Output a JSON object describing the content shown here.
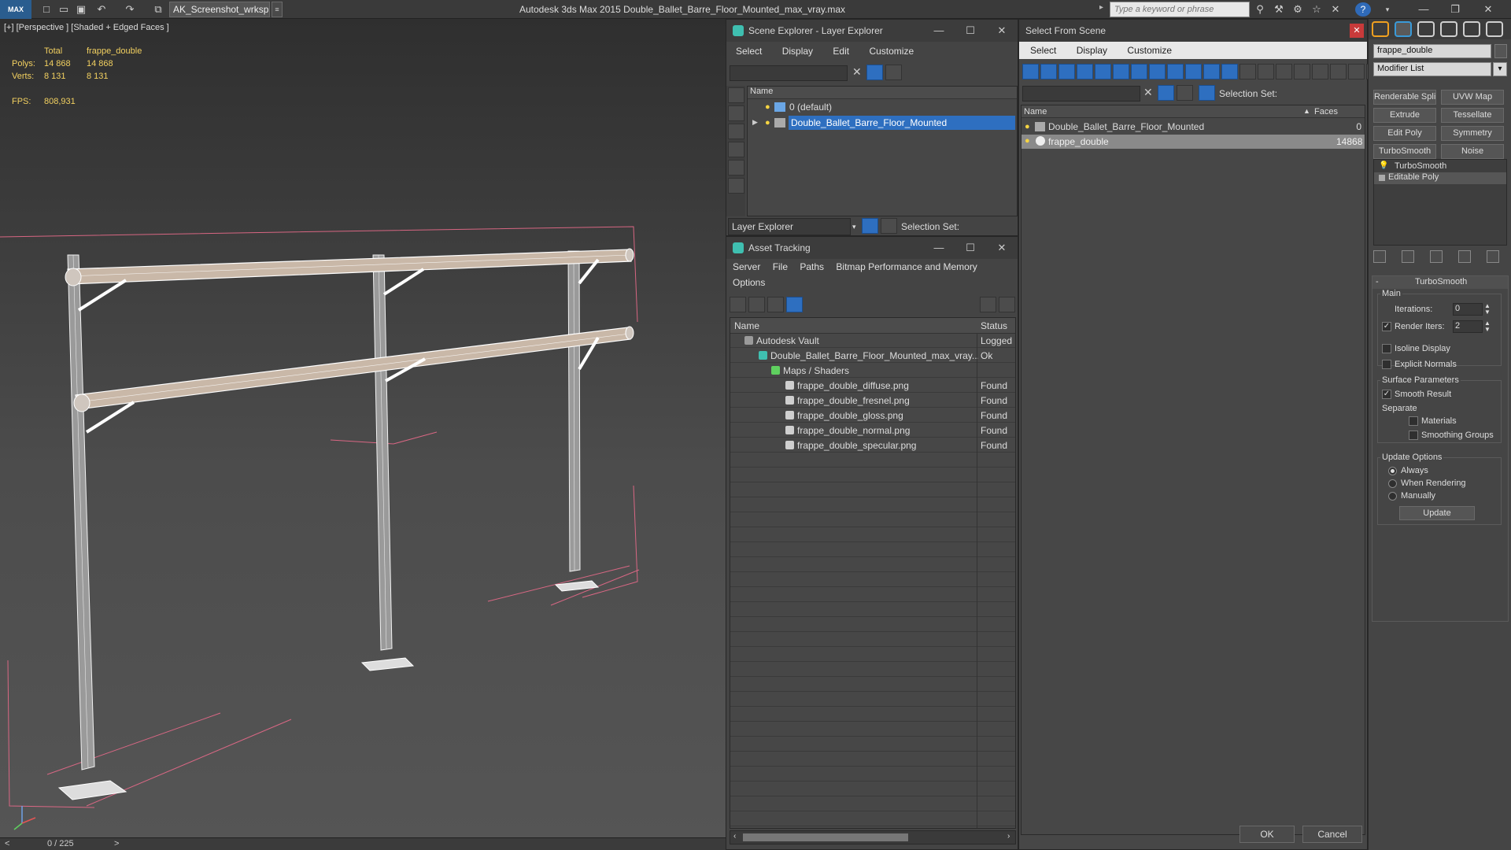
{
  "titlebar": {
    "app_logo": "MAX",
    "workspace": "AK_Screenshot_wrksp",
    "title": "Autodesk 3ds Max  2015     Double_Ballet_Barre_Floor_Mounted_max_vray.max",
    "search_placeholder": "Type a keyword or phrase"
  },
  "viewport": {
    "label": "[+] [Perspective ] [Shaded + Edged Faces ]",
    "stats_col1": "Total",
    "stats_col2": "frappe_double",
    "polys_label": "Polys:",
    "polys_total": "14 868",
    "polys_sel": "14 868",
    "verts_label": "Verts:",
    "verts_total": "8 131",
    "verts_sel": "8 131",
    "fps_label": "FPS:",
    "fps_value": "808,931",
    "time_slider": "0 / 225",
    "time_prev": "<",
    "time_next": ">"
  },
  "scene_explorer": {
    "title": "Scene Explorer - Layer Explorer",
    "menus": [
      "Select",
      "Display",
      "Edit",
      "Customize"
    ],
    "col_name": "Name",
    "layers": [
      "0 (default)",
      "Double_Ballet_Barre_Floor_Mounted"
    ],
    "footer_dropdown": "Layer Explorer",
    "selection_set": "Selection Set:"
  },
  "asset_tracking": {
    "title": "Asset Tracking",
    "menus": [
      "Server",
      "File",
      "Paths",
      "Bitmap Performance and Memory"
    ],
    "menu_options": "Options",
    "col_name": "Name",
    "col_status": "Status",
    "rows": [
      {
        "name": "Autodesk Vault",
        "status": "Logged"
      },
      {
        "name": "Double_Ballet_Barre_Floor_Mounted_max_vray....",
        "status": "Ok"
      },
      {
        "name": "Maps / Shaders",
        "status": ""
      },
      {
        "name": "frappe_double_diffuse.png",
        "status": "Found"
      },
      {
        "name": "frappe_double_fresnel.png",
        "status": "Found"
      },
      {
        "name": "frappe_double_gloss.png",
        "status": "Found"
      },
      {
        "name": "frappe_double_normal.png",
        "status": "Found"
      },
      {
        "name": "frappe_double_specular.png",
        "status": "Found"
      }
    ]
  },
  "select_from_scene": {
    "title": "Select From Scene",
    "menus": [
      "Select",
      "Display",
      "Customize"
    ],
    "selection_set": "Selection Set:",
    "col_name": "Name",
    "col_faces": "Faces",
    "rows": [
      {
        "name": "Double_Ballet_Barre_Floor_Mounted",
        "faces": "0"
      },
      {
        "name": "frappe_double",
        "faces": "14868"
      }
    ],
    "ok": "OK",
    "cancel": "Cancel"
  },
  "command_panel": {
    "object_name": "frappe_double",
    "modifier_list": "Modifier List",
    "mod_buttons": [
      "Renderable Spline",
      "UVW Map",
      "Extrude",
      "Tessellate",
      "Edit Poly",
      "Symmetry",
      "TurboSmooth",
      "Noise"
    ],
    "stack": [
      "TurboSmooth",
      "Editable Poly"
    ],
    "rollout": "TurboSmooth",
    "main": "Main",
    "iterations_label": "Iterations:",
    "iterations": "0",
    "render_iters_label": "Render Iters:",
    "render_iters": "2",
    "isoline": "Isoline Display",
    "explicit": "Explicit Normals",
    "surface": "Surface Parameters",
    "smooth_result": "Smooth Result",
    "separate": "Separate",
    "materials": "Materials",
    "smoothing_groups": "Smoothing Groups",
    "update_options": "Update Options",
    "always": "Always",
    "when_rendering": "When Rendering",
    "manually": "Manually",
    "update": "Update"
  }
}
